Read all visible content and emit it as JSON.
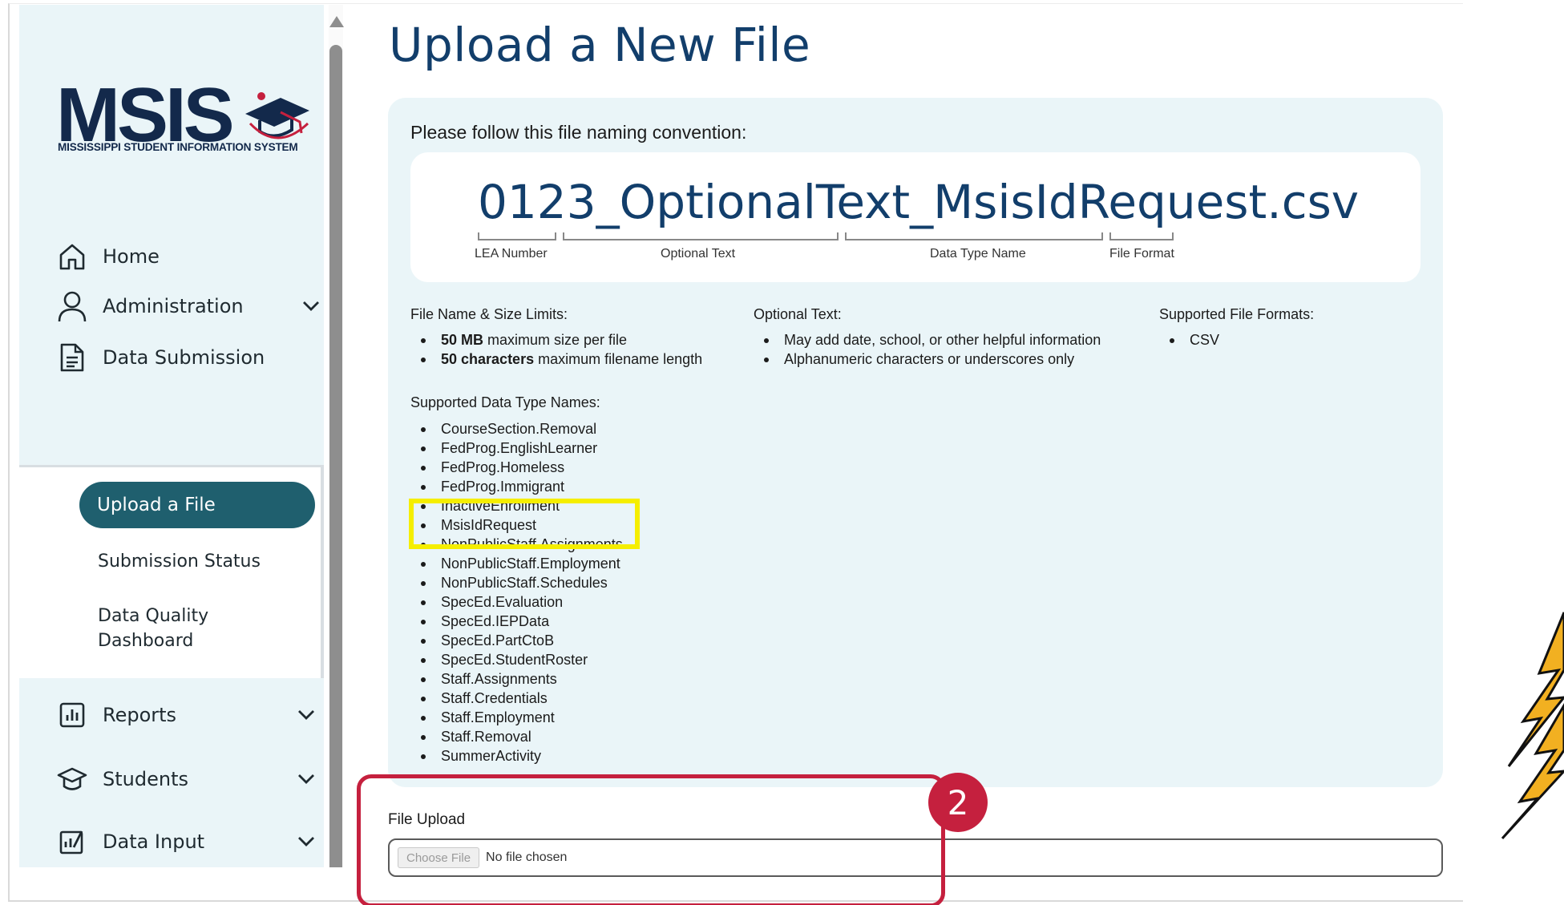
{
  "logo": {
    "wordmark": "MSIS",
    "subtitle": "MISSISSIPPI STUDENT INFORMATION SYSTEM"
  },
  "sidebar": {
    "items": [
      {
        "label": "Home",
        "icon": "home-icon"
      },
      {
        "label": "Administration",
        "icon": "user-icon"
      },
      {
        "label": "Data Submission",
        "icon": "document-icon"
      },
      {
        "label": "Reports",
        "icon": "bar-chart-icon"
      },
      {
        "label": "Students",
        "icon": "graduation-cap-icon"
      },
      {
        "label": "Data Input",
        "icon": "data-input-icon"
      }
    ],
    "sub_items": [
      {
        "label": "Upload a File"
      },
      {
        "label": "Submission Status"
      },
      {
        "label": "Data Quality",
        "label2": "Dashboard"
      }
    ]
  },
  "main": {
    "title": "Upload a New File",
    "naming_label": "Please follow this file naming convention:",
    "filename": {
      "lea": "0123",
      "sep1": "_",
      "optional": "OptionalText",
      "sep2": "_",
      "datatype": "MsisIdRequest",
      "ext": ".csv"
    },
    "segment_labels": {
      "lea": "LEA Number",
      "optional": "Optional Text",
      "datatype": "Data Type Name",
      "format": "File Format"
    },
    "limits": {
      "heading": "File Name & Size Limits:",
      "items": [
        {
          "bold": "50 MB",
          "rest": " maximum size per file"
        },
        {
          "bold": "50 characters",
          "rest": " maximum filename length"
        }
      ]
    },
    "optional_text": {
      "heading": "Optional Text:",
      "items": [
        "May add date, school, or other helpful information",
        "Alphanumeric characters or underscores only"
      ]
    },
    "formats": {
      "heading": "Supported File Formats:",
      "items": [
        "CSV"
      ]
    },
    "data_types": {
      "heading": "Supported Data Type Names:",
      "items": [
        "CourseSection.Removal",
        "FedProg.EnglishLearner",
        "FedProg.Homeless",
        "FedProg.Immigrant",
        "InactiveEnrollment",
        "MsisIdRequest",
        "NonPublicStaff.Assignments",
        "NonPublicStaff.Employment",
        "NonPublicStaff.Schedules",
        "SpecEd.Evaluation",
        "SpecEd.IEPData",
        "SpecEd.PartCtoB",
        "SpecEd.StudentRoster",
        "Staff.Assignments",
        "Staff.Credentials",
        "Staff.Employment",
        "Staff.Removal",
        "SummerActivity"
      ]
    },
    "upload": {
      "label": "File Upload",
      "button": "Choose File",
      "status": "No file chosen"
    },
    "annotation_number": "2"
  },
  "colors": {
    "primary": "#123e6b",
    "accent": "#1f5f6e",
    "highlight": "#f5ee00",
    "annotation": "#c5203e",
    "panel": "#eaf5f8"
  }
}
